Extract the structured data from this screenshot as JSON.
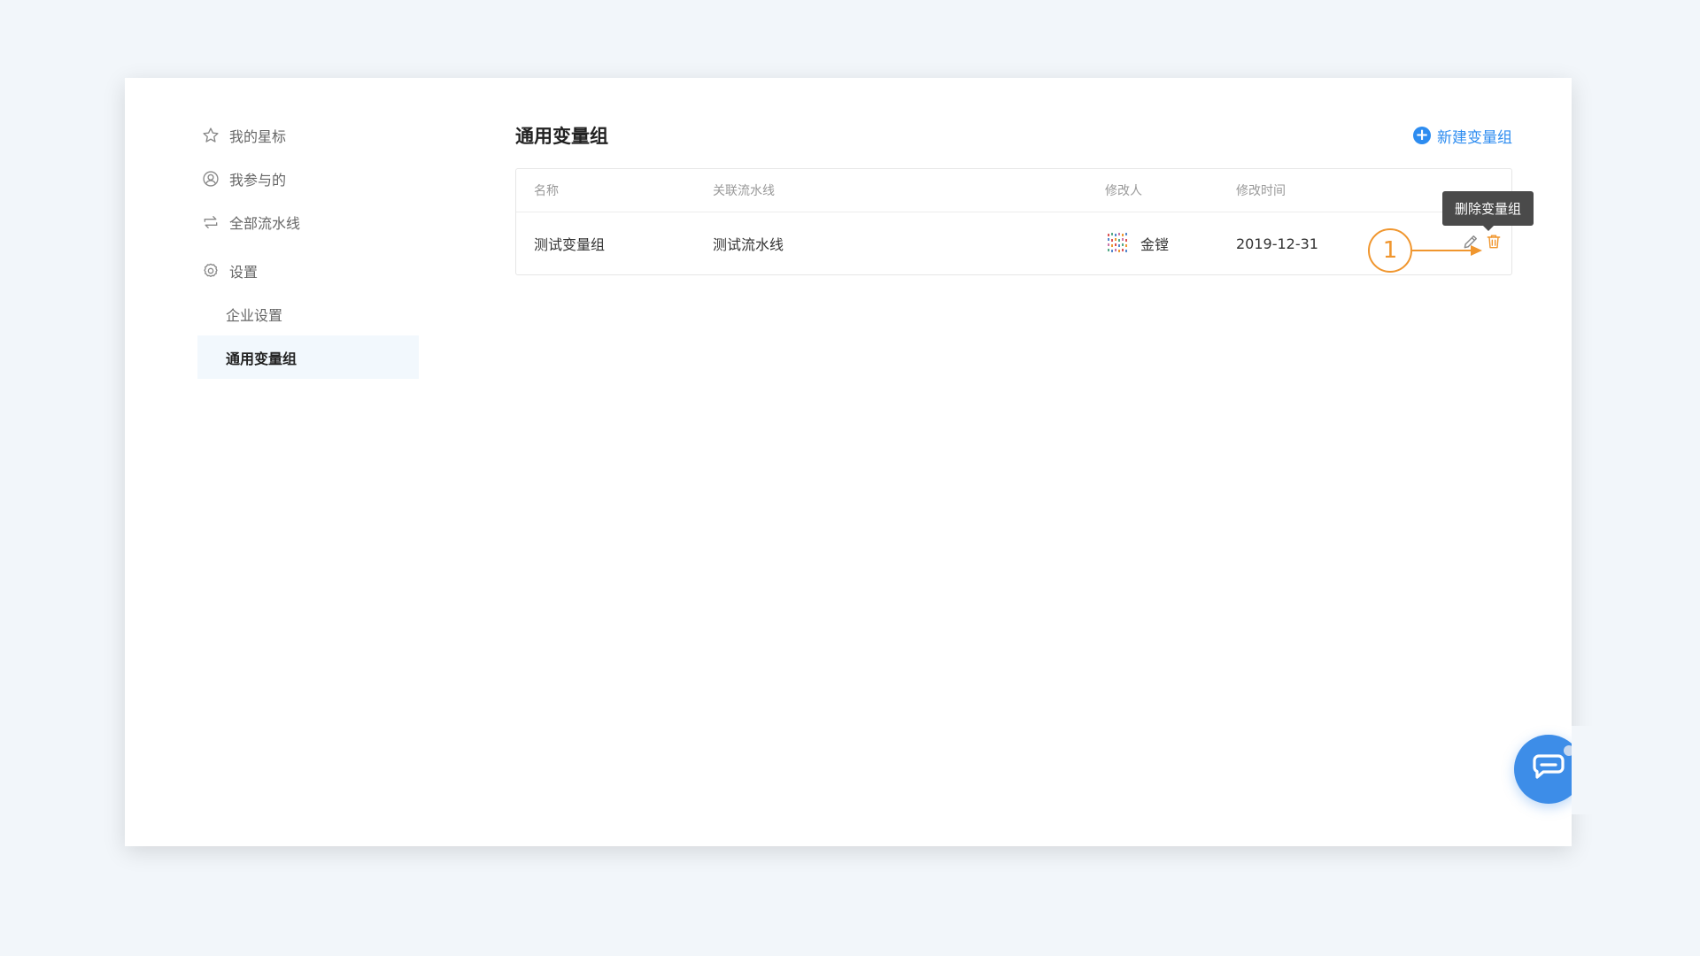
{
  "sidebar": {
    "items": [
      {
        "label": "我的星标",
        "icon": "star-icon"
      },
      {
        "label": "我参与的",
        "icon": "user-circle-icon"
      },
      {
        "label": "全部流水线",
        "icon": "swap-arrows-icon"
      },
      {
        "label": "设置",
        "icon": "gear-icon"
      }
    ],
    "sub_items": [
      {
        "label": "企业设置"
      },
      {
        "label": "通用变量组"
      }
    ]
  },
  "main": {
    "title": "通用变量组",
    "new_button_label": "新建变量组",
    "table": {
      "columns": [
        "名称",
        "关联流水线",
        "修改人",
        "修改时间"
      ],
      "rows": [
        {
          "name": "测试变量组",
          "pipeline": "测试流水线",
          "modifier": "金镗",
          "time": "2019-12-31"
        }
      ]
    },
    "tooltip": "删除变量组",
    "step_badge": "1"
  },
  "colors": {
    "accent": "#2d8cf0",
    "annotation": "#f0962e",
    "tooltip_bg": "#4a4a4a",
    "active_bg": "#f2f8fd",
    "chat_button": "#3d8de8"
  },
  "icons": {
    "edit": "pencil-icon",
    "delete": "trash-icon",
    "chat": "chat-bubble-icon",
    "add": "plus-circle-icon"
  }
}
